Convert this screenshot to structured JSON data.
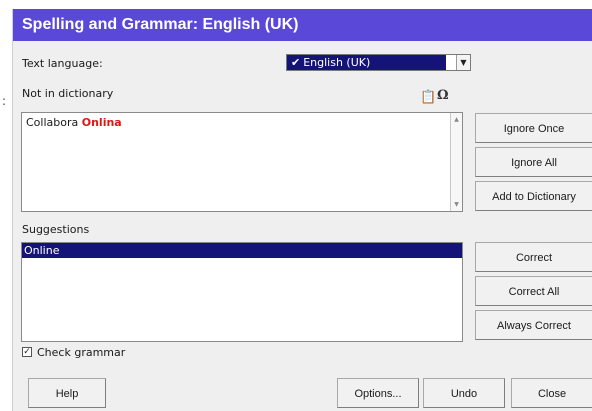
{
  "window": {
    "title": "Spelling and Grammar: English (UK)",
    "accent_color": "#5a48d8"
  },
  "text_language": {
    "label": "Text language:",
    "selected": "English (UK)",
    "check_glyph": "✔"
  },
  "not_in_dictionary": {
    "label": "Not in dictionary",
    "tool_icons": [
      "paste-icon",
      "special-character-icon"
    ],
    "sentence_prefix": "Collabora ",
    "error_word": "Onlina",
    "error_color": "#e21515"
  },
  "suggestions": {
    "label": "Suggestions",
    "items": [
      "Online"
    ]
  },
  "check_grammar": {
    "label": "Check grammar",
    "checked": true
  },
  "right_buttons": {
    "ignore_once": "Ignore Once",
    "ignore_all": "Ignore All",
    "add_to_dictionary": "Add to Dictionary",
    "correct": "Correct",
    "correct_all": "Correct All",
    "always_correct": "Always Correct"
  },
  "bottom_buttons": {
    "help": "Help",
    "options": "Options...",
    "undo": "Undo",
    "close": "Close"
  }
}
